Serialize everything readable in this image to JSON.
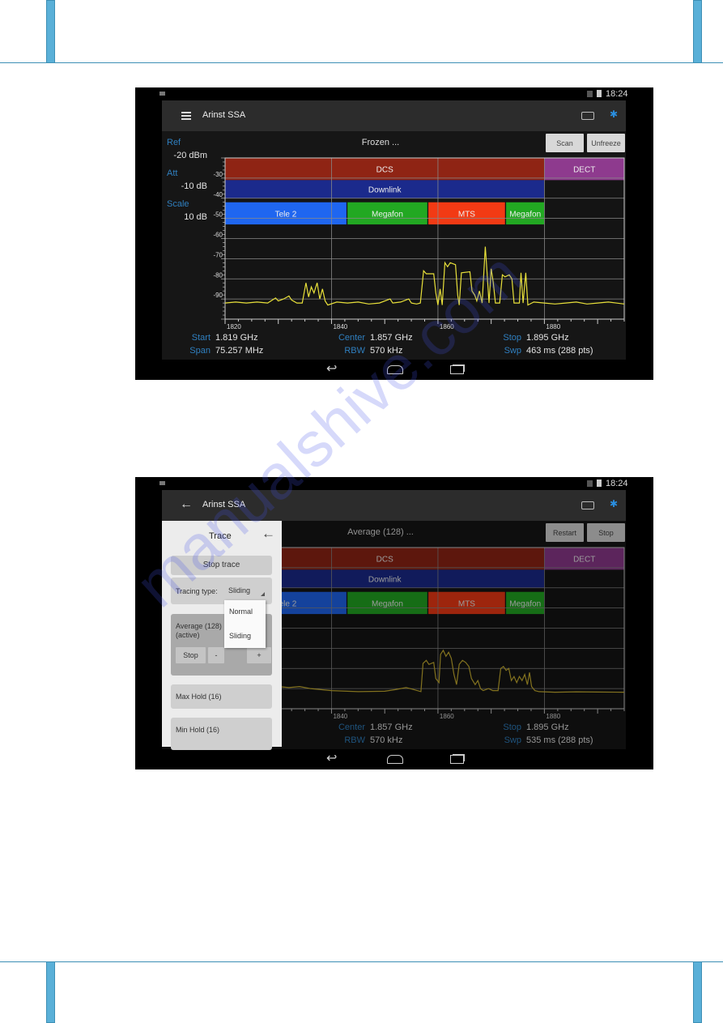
{
  "watermark": "manualshive.com",
  "screens": [
    {
      "status_time": "18:24",
      "app_title": "Arinst SSA",
      "nav_icon": "hamburger-menu-icon",
      "status_text": "Frozen ...",
      "buttons": [
        "Scan",
        "Unfreeze"
      ],
      "left_panel": [
        {
          "label": "Ref",
          "value": "-20 dBm"
        },
        {
          "label": "Att",
          "value": "-10 dB"
        },
        {
          "label": "Scale",
          "value": "10  dB"
        }
      ],
      "readouts": [
        {
          "label": "Start",
          "value": "1.819 GHz"
        },
        {
          "label": "Span",
          "value": "75.257 MHz"
        },
        {
          "label": "Center",
          "value": "1.857 GHz"
        },
        {
          "label": "RBW",
          "value": "570 kHz"
        },
        {
          "label": "Stop",
          "value": "1.895 GHz"
        },
        {
          "label": "Swp",
          "value": "463 ms (288 pts)"
        }
      ],
      "dimmed": false,
      "chart_data": {
        "type": "line",
        "xlim": [
          1820,
          1895
        ],
        "ylim": [
          -100,
          -20
        ],
        "x_ticks": [
          "1820",
          "1840",
          "1860",
          "1880"
        ],
        "y_ticks": [
          "-30",
          "-40",
          "-50",
          "-60",
          "-70",
          "-80",
          "-90"
        ],
        "grid": true,
        "trace_color": "#e8e03a",
        "bands": [
          {
            "label": "DCS",
            "f0": 1820,
            "f1": 1880,
            "top": -20,
            "bottom": -31,
            "color": "#8f2414"
          },
          {
            "label": "DECT",
            "f0": 1880,
            "f1": 1895,
            "top": -20,
            "bottom": -31,
            "color": "#8e3a8e"
          },
          {
            "label": "Downlink",
            "f0": 1820,
            "f1": 1880,
            "top": -31,
            "bottom": -40,
            "color": "#1b2a8c"
          },
          {
            "label": "Tele 2",
            "f0": 1820,
            "f1": 1842.8,
            "top": -42,
            "bottom": -53,
            "color": "#1f66f0"
          },
          {
            "label": "Megafon",
            "f0": 1843,
            "f1": 1858,
            "top": -42,
            "bottom": -53,
            "color": "#22a822"
          },
          {
            "label": "MTS",
            "f0": 1858.2,
            "f1": 1872.6,
            "top": -42,
            "bottom": -53,
            "color": "#f23a14"
          },
          {
            "label": "Megafon",
            "f0": 1872.8,
            "f1": 1880,
            "top": -42,
            "bottom": -53,
            "color": "#22a822"
          }
        ],
        "trace": [
          [
            1820,
            -92
          ],
          [
            1822,
            -91.5
          ],
          [
            1824,
            -92
          ],
          [
            1826,
            -91.5
          ],
          [
            1828,
            -92
          ],
          [
            1829.5,
            -89.5
          ],
          [
            1830,
            -91
          ],
          [
            1831,
            -90
          ],
          [
            1832,
            -88.5
          ],
          [
            1832.5,
            -90.5
          ],
          [
            1833.5,
            -92
          ],
          [
            1834.5,
            -92
          ],
          [
            1835.2,
            -82
          ],
          [
            1835.7,
            -89
          ],
          [
            1836.2,
            -84
          ],
          [
            1836.7,
            -87
          ],
          [
            1837.3,
            -82
          ],
          [
            1837.8,
            -90
          ],
          [
            1838.3,
            -85
          ],
          [
            1838.8,
            -91
          ],
          [
            1839.3,
            -93
          ],
          [
            1841,
            -91.5
          ],
          [
            1843,
            -92
          ],
          [
            1845,
            -91.5
          ],
          [
            1847,
            -92.5
          ],
          [
            1849,
            -92
          ],
          [
            1851,
            -90
          ],
          [
            1851.5,
            -92
          ],
          [
            1853,
            -91.5
          ],
          [
            1854.5,
            -90
          ],
          [
            1855,
            -92
          ],
          [
            1856,
            -92.5
          ],
          [
            1856.7,
            -92
          ],
          [
            1857.3,
            -76
          ],
          [
            1857.8,
            -77.5
          ],
          [
            1859.2,
            -77.5
          ],
          [
            1859.6,
            -87
          ],
          [
            1860,
            -93
          ],
          [
            1860.4,
            -85
          ],
          [
            1860.8,
            -93
          ],
          [
            1861.3,
            -72
          ],
          [
            1861.8,
            -74
          ],
          [
            1862.3,
            -72
          ],
          [
            1863.3,
            -73
          ],
          [
            1863.7,
            -88
          ],
          [
            1864,
            -93
          ],
          [
            1864.4,
            -77
          ],
          [
            1866,
            -76.5
          ],
          [
            1866.4,
            -86
          ],
          [
            1866.9,
            -88
          ],
          [
            1867.3,
            -91
          ],
          [
            1867.8,
            -86
          ],
          [
            1868.3,
            -92
          ],
          [
            1868.9,
            -64
          ],
          [
            1869.3,
            -80
          ],
          [
            1869.6,
            -92
          ],
          [
            1870,
            -75
          ],
          [
            1870.4,
            -82
          ],
          [
            1870.8,
            -92
          ],
          [
            1871.6,
            -92
          ],
          [
            1872.1,
            -78
          ],
          [
            1872.6,
            -79
          ],
          [
            1873.4,
            -78
          ],
          [
            1873.9,
            -80
          ],
          [
            1874.3,
            -92
          ],
          [
            1875.3,
            -92
          ],
          [
            1875.6,
            -77
          ],
          [
            1876,
            -92
          ],
          [
            1876.5,
            -77
          ],
          [
            1876.9,
            -93
          ],
          [
            1878,
            -91.5
          ],
          [
            1880,
            -92
          ],
          [
            1882,
            -92.5
          ],
          [
            1884,
            -92
          ],
          [
            1886,
            -91.5
          ],
          [
            1888,
            -92.5
          ],
          [
            1890,
            -92
          ],
          [
            1892,
            -91.5
          ],
          [
            1895,
            -92.5
          ]
        ]
      }
    },
    {
      "status_time": "18:24",
      "app_title": "Arinst SSA",
      "nav_icon": "back-arrow-icon",
      "status_text": "Average (128) ...",
      "buttons": [
        "Restart",
        "Stop"
      ],
      "left_panel": [],
      "readouts": [
        {
          "label": "Center",
          "value": "1.857 GHz"
        },
        {
          "label": "RBW",
          "value": "570 kHz"
        },
        {
          "label": "Stop",
          "value": "1.895 GHz"
        },
        {
          "label": "Swp",
          "value": "535 ms (288 pts)"
        }
      ],
      "dimmed": true,
      "chart_data": {
        "type": "line",
        "xlim": [
          1820,
          1895
        ],
        "ylim": [
          -100,
          -20
        ],
        "x_ticks": [
          "1840",
          "1860",
          "1880"
        ],
        "y_ticks": [],
        "grid": true,
        "trace_color": "#c9b030",
        "bands": [
          {
            "label": "DCS",
            "f0": 1820,
            "f1": 1880,
            "top": -20,
            "bottom": -31,
            "color": "#8f2414"
          },
          {
            "label": "DECT",
            "f0": 1880,
            "f1": 1895,
            "top": -20,
            "bottom": -31,
            "color": "#8e3a8e"
          },
          {
            "label": "Downlink",
            "f0": 1820,
            "f1": 1880,
            "top": -31,
            "bottom": -40,
            "color": "#1b2a8c"
          },
          {
            "label": "Tele 2",
            "f0": 1820,
            "f1": 1842.8,
            "top": -42,
            "bottom": -53,
            "color": "#1f66f0"
          },
          {
            "label": "Megafon",
            "f0": 1843,
            "f1": 1858,
            "top": -42,
            "bottom": -53,
            "color": "#22a822"
          },
          {
            "label": "MTS",
            "f0": 1858.2,
            "f1": 1872.6,
            "top": -42,
            "bottom": -53,
            "color": "#f23a14"
          },
          {
            "label": "Megafon",
            "f0": 1872.8,
            "f1": 1880,
            "top": -42,
            "bottom": -53,
            "color": "#22a822"
          }
        ],
        "trace": [
          [
            1820,
            -90
          ],
          [
            1825,
            -90
          ],
          [
            1828,
            -89.5
          ],
          [
            1830,
            -89
          ],
          [
            1832,
            -89.5
          ],
          [
            1834,
            -89
          ],
          [
            1836,
            -90
          ],
          [
            1838,
            -90.5
          ],
          [
            1840,
            -91
          ],
          [
            1845,
            -91.5
          ],
          [
            1850,
            -91.3
          ],
          [
            1852,
            -90.5
          ],
          [
            1854,
            -89.5
          ],
          [
            1855.5,
            -90.5
          ],
          [
            1856.8,
            -91.5
          ],
          [
            1857.2,
            -77.5
          ],
          [
            1857.8,
            -76
          ],
          [
            1858.3,
            -78
          ],
          [
            1859.2,
            -77
          ],
          [
            1859.6,
            -85
          ],
          [
            1860.2,
            -87
          ],
          [
            1860.5,
            -73
          ],
          [
            1861,
            -71
          ],
          [
            1861.5,
            -74
          ],
          [
            1862,
            -72
          ],
          [
            1862.5,
            -75
          ],
          [
            1863,
            -83
          ],
          [
            1863.5,
            -88
          ],
          [
            1864,
            -78
          ],
          [
            1864.6,
            -76
          ],
          [
            1865.2,
            -77
          ],
          [
            1865.8,
            -79
          ],
          [
            1866.3,
            -85
          ],
          [
            1867,
            -88
          ],
          [
            1867.5,
            -86
          ],
          [
            1868,
            -90
          ],
          [
            1868.5,
            -91
          ],
          [
            1869.5,
            -90
          ],
          [
            1870.3,
            -91
          ],
          [
            1871.3,
            -91
          ],
          [
            1871.8,
            -80
          ],
          [
            1872.3,
            -79
          ],
          [
            1872.8,
            -81
          ],
          [
            1873.3,
            -80
          ],
          [
            1873.8,
            -86
          ],
          [
            1874.3,
            -84
          ],
          [
            1874.8,
            -87
          ],
          [
            1875.3,
            -84
          ],
          [
            1875.8,
            -86
          ],
          [
            1876.3,
            -83
          ],
          [
            1876.8,
            -88
          ],
          [
            1877.2,
            -82
          ],
          [
            1877.6,
            -89
          ],
          [
            1878.2,
            -91
          ],
          [
            1879,
            -91.5
          ],
          [
            1882,
            -91.8
          ],
          [
            1886,
            -91.6
          ],
          [
            1890,
            -91.7
          ],
          [
            1895,
            -91.8
          ]
        ]
      },
      "drawer": {
        "title": "Trace",
        "stop_trace": "Stop trace",
        "tracing_type_label": "Tracing type:",
        "tracing_type_value": "Sliding",
        "options": [
          "Normal",
          "Sliding"
        ],
        "average_line1": "Average (128)",
        "average_line2": "(active)",
        "average_buttons": [
          "Stop",
          "-",
          "+"
        ],
        "max_hold": "Max Hold (16)",
        "min_hold": "Min Hold (16)"
      }
    }
  ]
}
